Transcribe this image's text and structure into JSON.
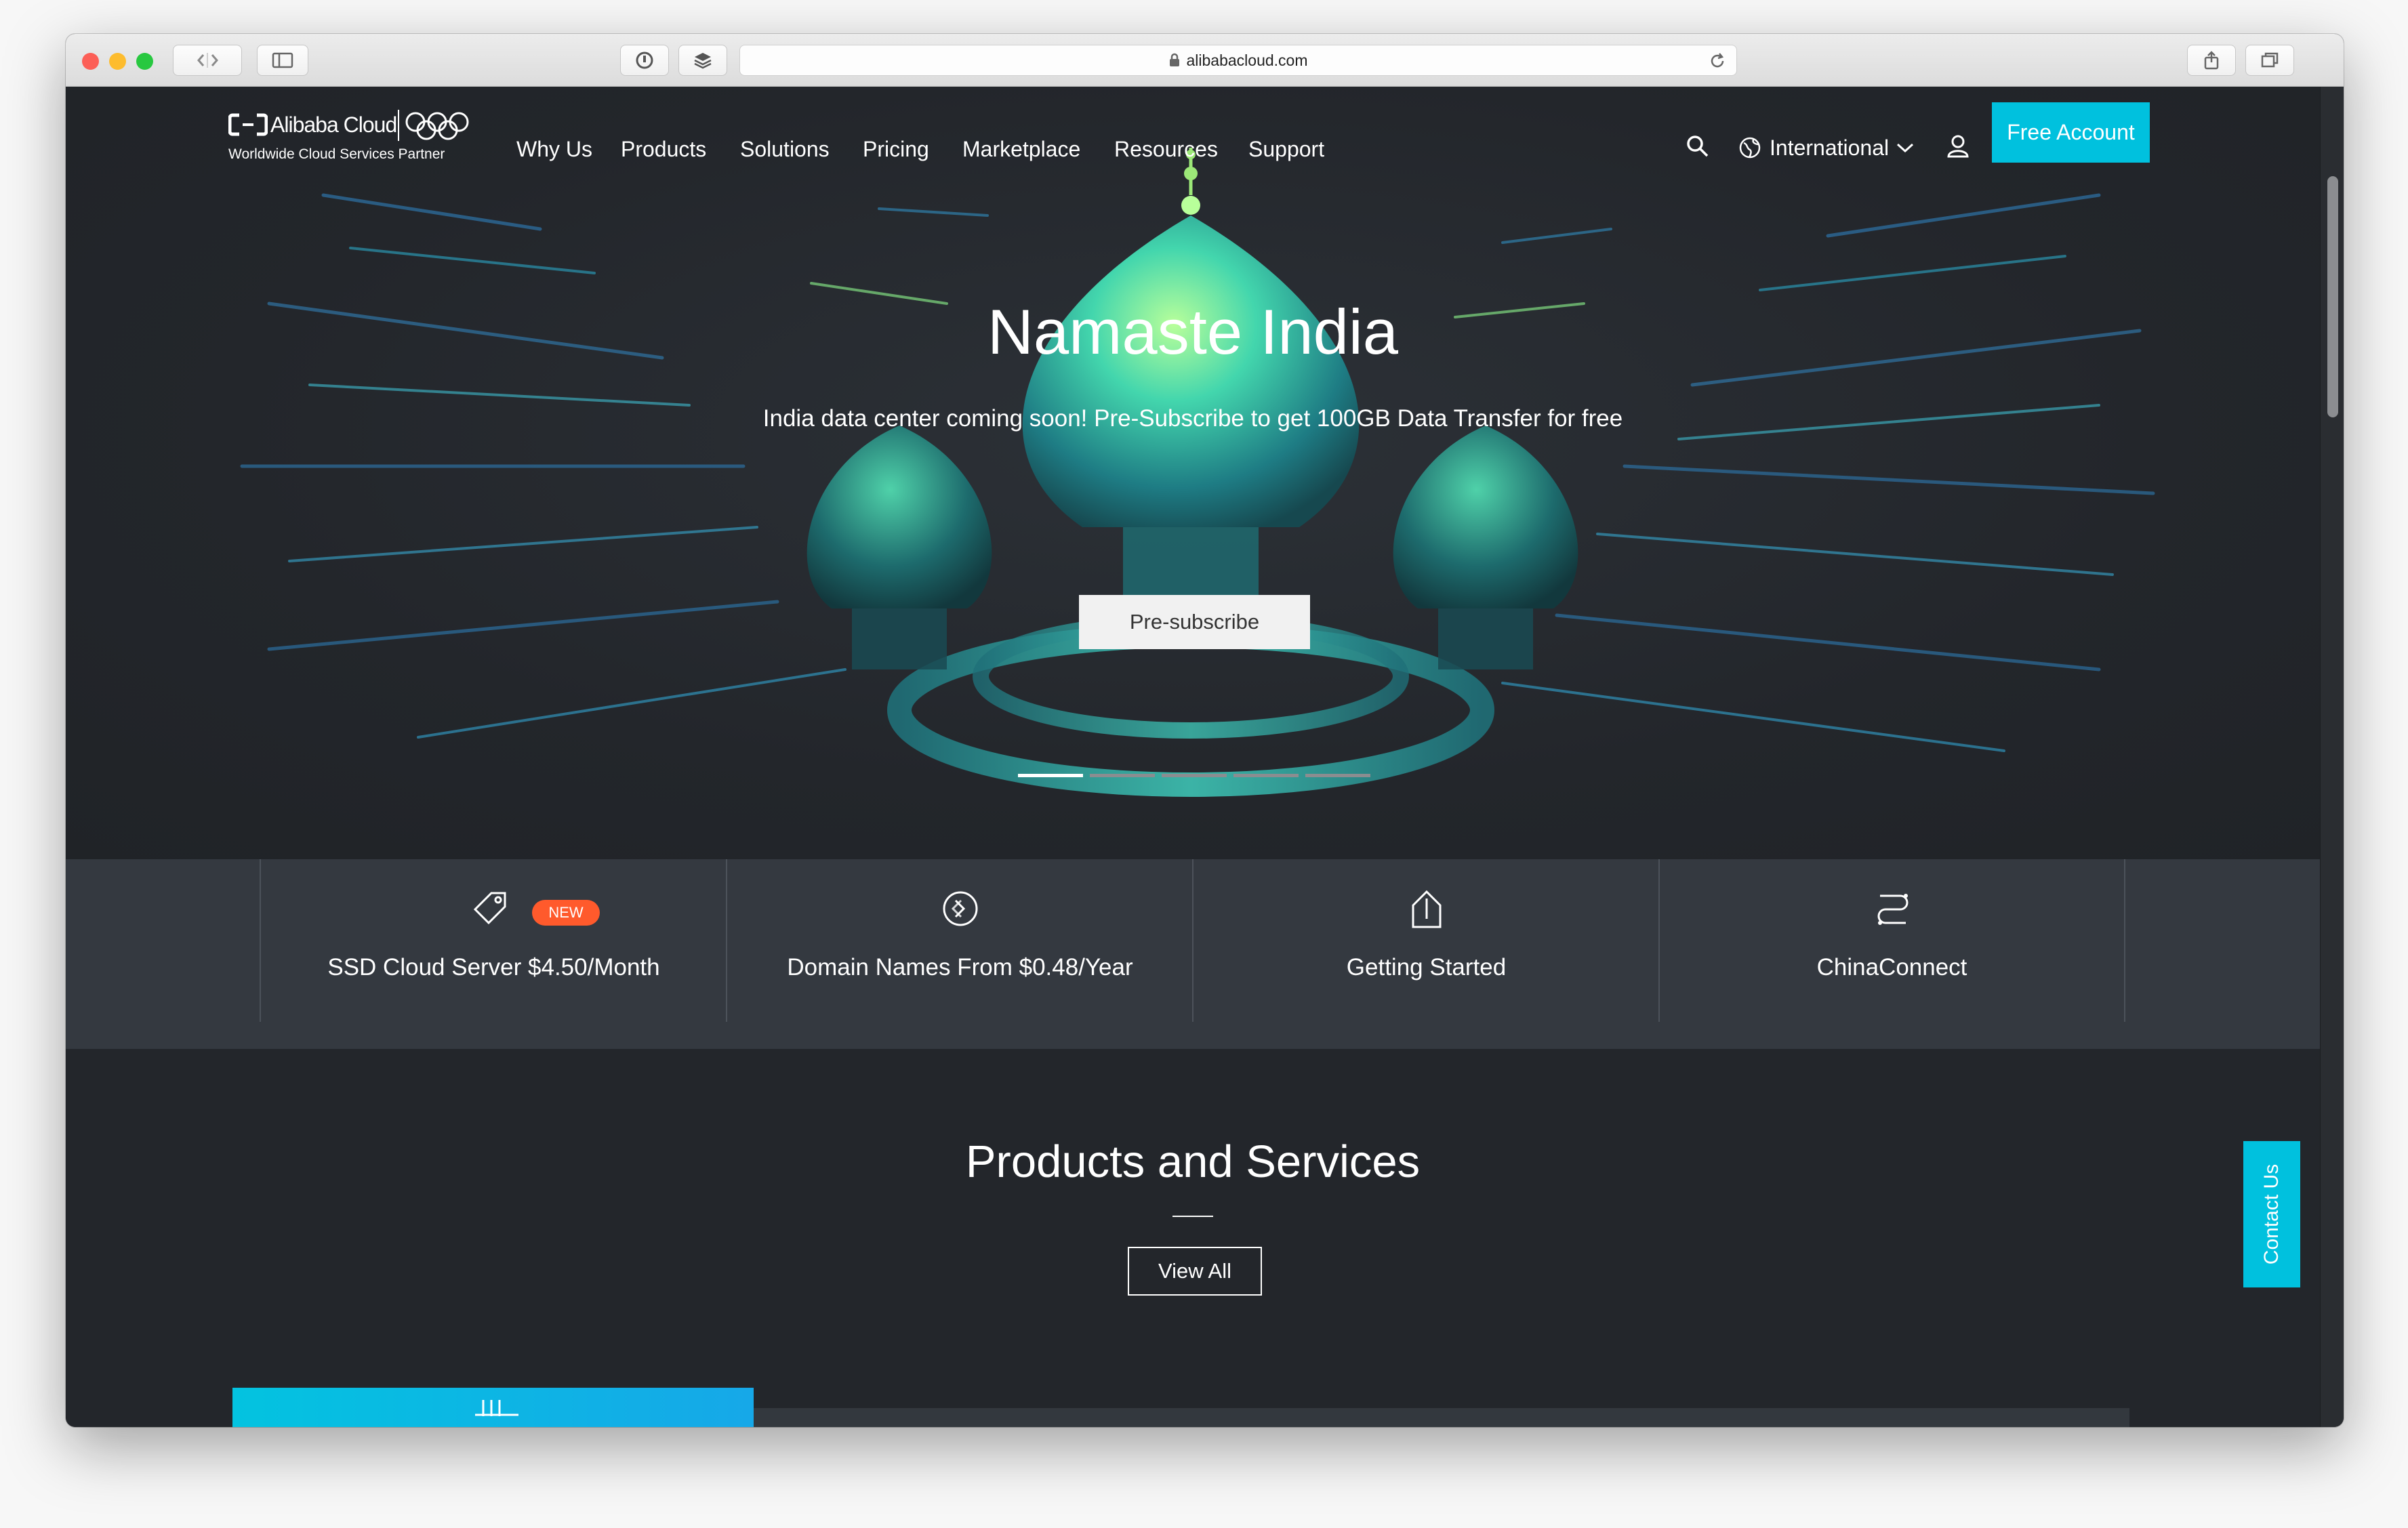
{
  "browser": {
    "url": "alibabacloud.com"
  },
  "header": {
    "logo_text": "Alibaba Cloud",
    "tagline": "Worldwide Cloud Services Partner",
    "nav": [
      "Why Us",
      "Products",
      "Solutions",
      "Pricing",
      "Marketplace",
      "Resources",
      "Support"
    ],
    "region": "International",
    "cta": "Free Account"
  },
  "hero": {
    "title": "Namaste India",
    "subtitle": "India data center coming soon! Pre-Subscribe to get 100GB Data Transfer for free",
    "button": "Pre-subscribe",
    "slides": 5,
    "active_slide": 0
  },
  "quick_links": [
    {
      "label": "SSD Cloud Server $4.50/Month",
      "badge": "NEW",
      "icon": "price-tag-icon"
    },
    {
      "label": "Domain Names From $0.48/Year",
      "icon": "domain-icon"
    },
    {
      "label": "Getting Started",
      "icon": "upload-arrow-icon"
    },
    {
      "label": "ChinaConnect",
      "icon": "connect-icon"
    }
  ],
  "products": {
    "title": "Products and Services",
    "view_all": "View All"
  },
  "side_tab": "Contact Us",
  "colors": {
    "accent": "#00c1de",
    "badge": "#ff5a2c",
    "background": "#23262b",
    "panel": "#343940"
  }
}
